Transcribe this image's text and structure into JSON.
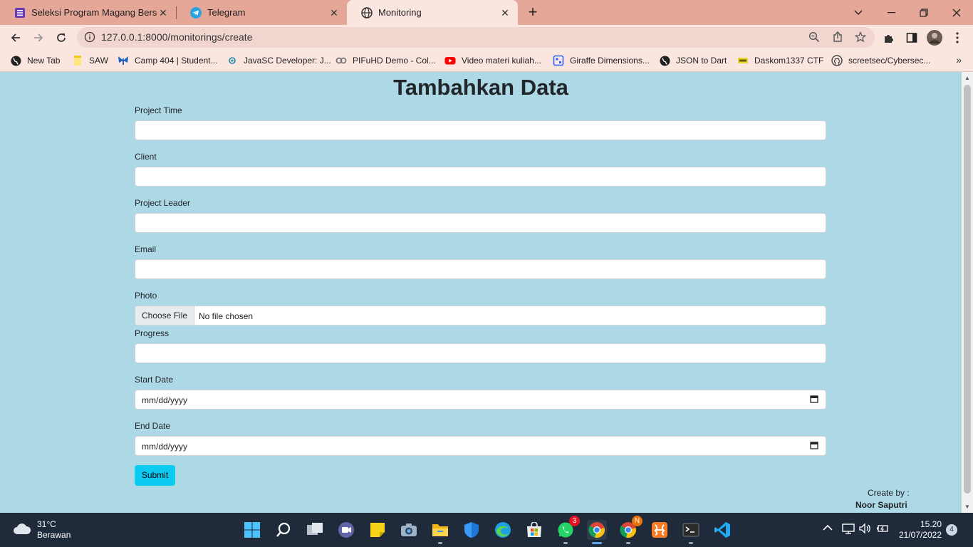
{
  "browser": {
    "tabs": [
      {
        "title": "Seleksi Program Magang Bersert",
        "icon": "forms-icon",
        "active": false
      },
      {
        "title": "Telegram",
        "icon": "telegram-icon",
        "active": false
      },
      {
        "title": "Monitoring",
        "icon": "globe-icon",
        "active": true
      }
    ],
    "url": "127.0.0.1:8000/monitorings/create",
    "bookmarks": [
      {
        "label": "New Tab",
        "icon": "globe-icon"
      },
      {
        "label": "SAW",
        "icon": "folder-icon"
      },
      {
        "label": "Camp 404 | Student...",
        "icon": "butterfly-icon"
      },
      {
        "label": "JavaSC Developer: J...",
        "icon": "javasc-icon"
      },
      {
        "label": "PIFuHD Demo - Col...",
        "icon": "colab-icon"
      },
      {
        "label": "Video materi kuliah...",
        "icon": "youtube-icon"
      },
      {
        "label": "Giraffe Dimensions...",
        "icon": "giraffe-icon"
      },
      {
        "label": "JSON to Dart",
        "icon": "globe-icon"
      },
      {
        "label": "Daskom1337 CTF",
        "icon": "daskom-icon"
      },
      {
        "label": "screetsec/Cybersec...",
        "icon": "github-icon"
      }
    ]
  },
  "form": {
    "heading": "Tambahkan Data",
    "fields": {
      "project_time": {
        "label": "Project Time",
        "value": ""
      },
      "client": {
        "label": "Client",
        "value": ""
      },
      "project_leader": {
        "label": "Project Leader",
        "value": ""
      },
      "email": {
        "label": "Email",
        "value": ""
      },
      "photo": {
        "label": "Photo",
        "button": "Choose File",
        "status": "No file chosen"
      },
      "progress": {
        "label": "Progress",
        "value": ""
      },
      "start_date": {
        "label": "Start Date",
        "placeholder": "mm/dd/yyyy"
      },
      "end_date": {
        "label": "End Date",
        "placeholder": "mm/dd/yyyy"
      }
    },
    "submit": "Submit"
  },
  "footer": {
    "created_by_label": "Create by :",
    "author": "Noor Saputri"
  },
  "taskbar": {
    "weather": {
      "temp": "31°C",
      "condition": "Berawan"
    },
    "whatsapp_badge": "3",
    "chrome2_badge": "N",
    "clock": {
      "time": "15.20",
      "date": "21/07/2022"
    },
    "notifications": "4"
  },
  "colors": {
    "page_bg": "#add8e6",
    "chrome_frame": "#e4a798",
    "chrome_toolbar": "#fbe5df",
    "submit_button": "#0dcaf0",
    "taskbar": "#1f2a3a"
  }
}
